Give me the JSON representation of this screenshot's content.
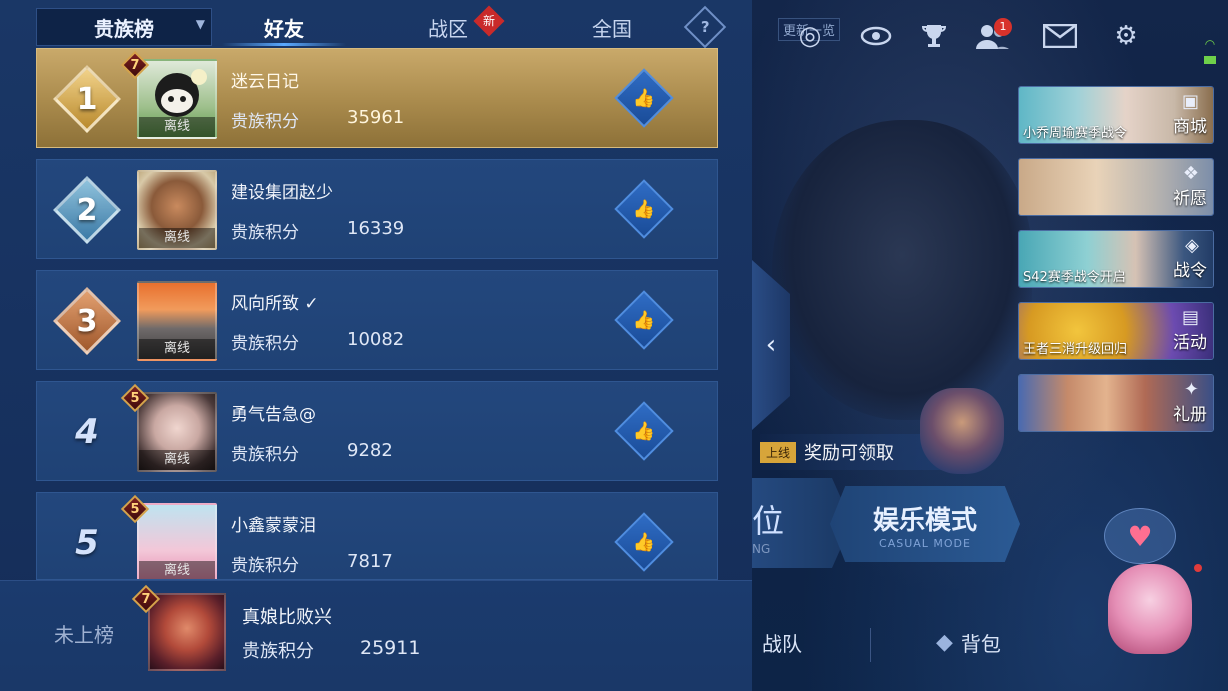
{
  "tabs": {
    "dropdown_label": "贵族榜",
    "friends": "好友",
    "region": "战区",
    "region_badge": "新",
    "national": "全国",
    "help": "?"
  },
  "rows": [
    {
      "rank": "1",
      "vip": "7",
      "name": "迷云日记",
      "score_label": "贵族积分",
      "score": "35961",
      "status": "离线"
    },
    {
      "rank": "2",
      "vip": "",
      "name": "建设集团赵少",
      "score_label": "贵族积分",
      "score": "16339",
      "status": "离线"
    },
    {
      "rank": "3",
      "vip": "",
      "name": "风向所致 ✓",
      "score_label": "贵族积分",
      "score": "10082",
      "status": "离线"
    },
    {
      "rank": "4",
      "vip": "5",
      "name": "勇气告急@",
      "score_label": "贵族积分",
      "score": "9282",
      "status": "离线"
    },
    {
      "rank": "5",
      "vip": "5",
      "name": "小鑫蒙蒙泪",
      "score_label": "贵族积分",
      "score": "7817",
      "status": "离线"
    }
  ],
  "self": {
    "rank_text": "未上榜",
    "vip": "7",
    "name": "真娘比败兴",
    "score_label": "贵族积分",
    "score": "25911"
  },
  "game": {
    "update_tag": "更新一览",
    "mail_badge": "1",
    "side_cards": [
      {
        "caption": "小乔周瑜赛季战令",
        "label": "商城"
      },
      {
        "caption": "",
        "label": "祈愿"
      },
      {
        "caption": "S42赛季战令开启",
        "label": "战令"
      },
      {
        "caption": "王者三消升级回归",
        "label": "活动"
      },
      {
        "caption": "",
        "label": "礼册"
      }
    ],
    "online_tag": "上线",
    "reward_text": "奖励可领取",
    "mode_rank": "位",
    "mode_rank_sub": "NG",
    "mode_casual": "娱乐模式",
    "mode_casual_sub": "CASUAL MODE",
    "nav_team": "战队",
    "nav_bag": "背包"
  },
  "colors": {
    "panel": "#1a3766",
    "gold_row": "#c9a96a",
    "accent_blue": "#5aa9ff",
    "badge_red": "#c92a2a"
  },
  "icons": [
    "help-icon",
    "like-icon",
    "eye-icon",
    "trophy-icon",
    "friends-icon",
    "mail-icon",
    "gear-icon",
    "chevron-left-icon",
    "heart-icon"
  ]
}
